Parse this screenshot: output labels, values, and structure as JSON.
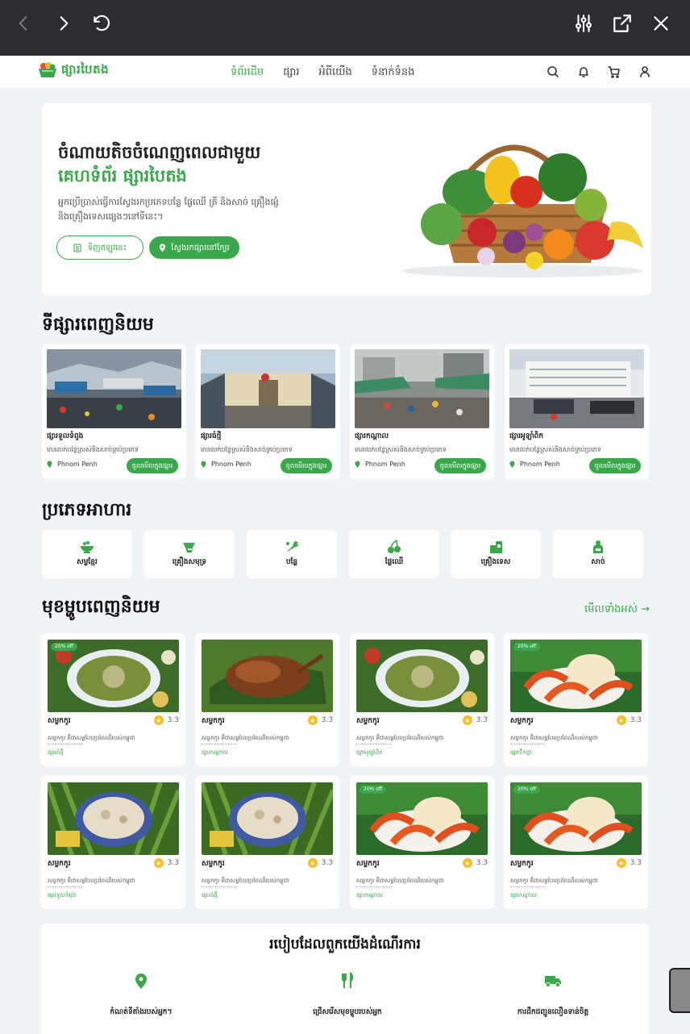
{
  "viewer": {
    "back_icon": "chevron-left-icon",
    "forward_icon": "chevron-right-icon",
    "reload_icon": "undo-icon",
    "settings_icon": "sliders-icon",
    "open_external_icon": "open-external-icon",
    "close_icon": "close-icon"
  },
  "header": {
    "logo_text": "ផ្សារបៃតង",
    "nav": [
      {
        "label": "ទំព័រដើម",
        "active": true
      },
      {
        "label": "ផ្សារ",
        "active": false
      },
      {
        "label": "អំពីយើង",
        "active": false
      },
      {
        "label": "ទំនាក់ទំនង",
        "active": false
      }
    ],
    "icons": [
      "search-icon",
      "bell-icon",
      "cart-icon",
      "user-icon"
    ]
  },
  "hero": {
    "title": "ចំណាយតិចចំណេញពេលជាមួយ",
    "subtitle": "គេហទំព័រ ផ្សារបៃតង",
    "description": "អ្នកប្រើប្រាស់ធ្វើការស្វែងរកប្រភេទបន្លែ ផ្លែឈើ ត្រី និងសាច់ គ្រឿងផ្សំនិងគ្រឿងទេសផ្សេងៗនៅទីនេះ។",
    "btn_scan": "ទិញឥឡូវនេះ",
    "btn_search": "ស្វែងរកផ្សារនៅក្បែរ"
  },
  "markets_section": {
    "title": "ទីផ្សារពេញនិយម",
    "items": [
      {
        "name": "ផ្សារទួលទំពូង",
        "desc": "មានលក់បន្លែស្រស់និងសាច់គ្រប់ប្រភេទ",
        "location": "Phnom Penh",
        "button": "ចូលមើលក្នុងផ្សារ"
      },
      {
        "name": "ផ្សារធំថ្មី",
        "desc": "មានលក់បន្លែស្រស់និងសាច់គ្រប់ប្រភេទ",
        "location": "Phnom Penh",
        "button": "ចូលមើលក្នុងផ្សារ"
      },
      {
        "name": "ផ្សារកណ្តាល",
        "desc": "មានលក់បន្លែស្រស់និងសាច់គ្រប់ប្រភេទ",
        "location": "Phnom Penh",
        "button": "ចូលមើលក្នុងផ្សារ"
      },
      {
        "name": "ផ្សារអូឡាំពិក",
        "desc": "មានលក់បន្លែស្រស់និងសាច់គ្រប់ប្រភេទ",
        "location": "Phnom Penh",
        "button": "ចូលមើលក្នុងផ្សារ"
      }
    ]
  },
  "categories_section": {
    "title": "ប្រភេទអាហារ",
    "items": [
      {
        "label": "សម្លខ្មែរ",
        "icon": "bowl-icon"
      },
      {
        "label": "គ្រឿងសមុទ្រ",
        "icon": "fish-icon"
      },
      {
        "label": "បន្លែ",
        "icon": "carrot-icon"
      },
      {
        "label": "ផ្លែឈើ",
        "icon": "cherry-icon"
      },
      {
        "label": "គ្រឿងទេស",
        "icon": "spice-jar-icon"
      },
      {
        "label": "សាច់",
        "icon": "butcher-icon"
      }
    ]
  },
  "dishes_section": {
    "title": "មុខម្ហូបពេញនិយម",
    "see_all": "មើលទាំងអស់ →",
    "items": [
      {
        "name": "សម្លកកូរ",
        "rating": "3.3",
        "badge": "20% off",
        "desc": "សម្លកកូរ គឺជាសម្លបែបប្រពៃណីរបស់កម្ពុជា",
        "market": "ផ្សារធំថ្មី",
        "image": "green-plate"
      },
      {
        "name": "សម្លកកូរ",
        "rating": "3.3",
        "badge": "",
        "desc": "សម្លកកូរ គឺជាសម្លបែបប្រពៃណីរបស់កម្ពុជា",
        "market": "ផ្សារកណ្តាល",
        "image": "roast-duck"
      },
      {
        "name": "សម្លកកូរ",
        "rating": "3.3",
        "badge": "",
        "desc": "សម្លកកូរ គឺជាសម្លបែបប្រពៃណីរបស់កម្ពុជា",
        "market": "ផ្សារអូឡាំពិក",
        "image": "green-plate"
      },
      {
        "name": "សម្លកកូរ",
        "rating": "3.3",
        "badge": "20% off",
        "desc": "សម្លកកូរ គឺជាសម្លបែបប្រពៃណីរបស់កម្ពុជា",
        "market": "ផ្សារទឹកថ្លា",
        "image": "shrimp"
      },
      {
        "name": "សម្លកកូរ",
        "rating": "3.3",
        "badge": "",
        "desc": "សម្លកកូរ គឺជាសម្លបែបប្រពៃណីរបស់កម្ពុជា",
        "market": "ផ្សារទួលទំពូង",
        "image": "soup-bowl"
      },
      {
        "name": "សម្លកកូរ",
        "rating": "3.3",
        "badge": "",
        "desc": "សម្លកកូរ គឺជាសម្លបែបប្រពៃណីរបស់កម្ពុជា",
        "market": "ផ្សារធំថ្មី",
        "image": "soup-bowl"
      },
      {
        "name": "សម្លកកូរ",
        "rating": "3.3",
        "badge": "20% off",
        "desc": "សម្លកកូរ គឺជាសម្លបែបប្រពៃណីរបស់កម្ពុជា",
        "market": "ផ្សារកណ្តាល",
        "image": "shrimp"
      },
      {
        "name": "សម្លកកូរ",
        "rating": "3.3",
        "badge": "20% off",
        "desc": "សម្លកកូរ គឺជាសម្លបែបប្រពៃណីរបស់កម្ពុជា",
        "market": "ផ្សារកណ្តាល",
        "image": "shrimp"
      }
    ]
  },
  "how_section": {
    "title": "របៀបដែលពួកយើងដំណើរការ",
    "items": [
      {
        "label": "កំណត់ទីតាំងរបស់អ្នក។",
        "icon": "location-pin-icon"
      },
      {
        "label": "ជ្រើសរើសមុខម្ហូបរបស់អ្នក",
        "icon": "fork-knife-icon"
      },
      {
        "label": "ការដឹកជញ្ជូនលឿនទាន់ចិត្ត",
        "icon": "delivery-truck-icon"
      }
    ]
  },
  "colors": {
    "accent": "#3aa84a",
    "viewer_bar": "#2b2d31",
    "page_bg": "#f1f4f7"
  }
}
